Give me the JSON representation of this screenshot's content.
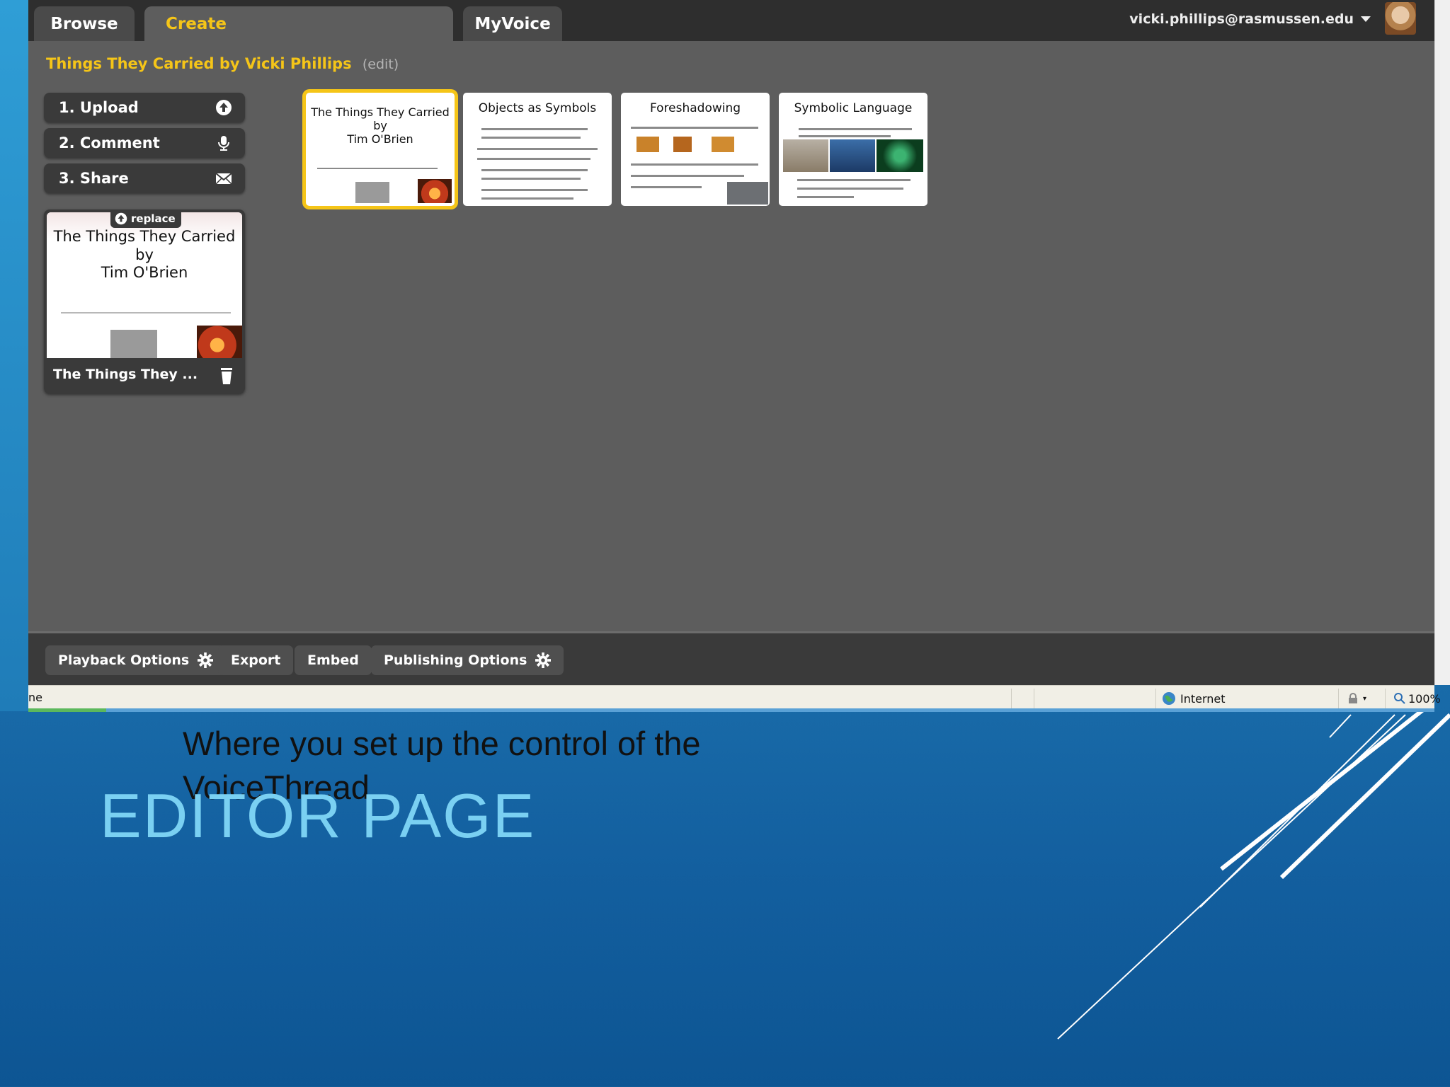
{
  "nav": {
    "tabs": [
      {
        "label": "Browse"
      },
      {
        "label": "Create"
      },
      {
        "label": "MyVoice"
      }
    ],
    "user_email": "vicki.phillips@rasmussen.edu"
  },
  "thread": {
    "title": "Things They Carried by Vicki Phillips",
    "edit_label": "(edit)"
  },
  "steps": [
    {
      "label": "1. Upload",
      "icon": "upload-icon"
    },
    {
      "label": "2. Comment",
      "icon": "microphone-icon"
    },
    {
      "label": "3. Share",
      "icon": "envelope-icon"
    }
  ],
  "selected_slide": {
    "replace_label": "replace",
    "title_line1": "The Things They Carried",
    "title_line2": "by",
    "title_line3": "Tim O'Brien",
    "caption": "The Things They ..."
  },
  "thumbnails": [
    {
      "title": "The Things They Carried",
      "sub1": "by",
      "sub2": "Tim O'Brien"
    },
    {
      "title": "Objects as Symbols"
    },
    {
      "title": "Foreshadowing"
    },
    {
      "title": "Symbolic Language"
    }
  ],
  "bottom_buttons": [
    {
      "label": "Playback Options",
      "icon": "gear-icon"
    },
    {
      "label": "Export"
    },
    {
      "label": "Embed"
    },
    {
      "label": "Publishing Options",
      "icon": "gear-icon"
    }
  ],
  "status_bar": {
    "left_text": "ne",
    "zone": "Internet",
    "zoom": "100%"
  },
  "slide": {
    "subtitle": "Where you set up the control of the VoiceThread",
    "heading": "EDITOR PAGE"
  },
  "colors": {
    "accent": "#f5c518",
    "heading": "#7ad0f2",
    "app_bg": "#5d5d5d",
    "topbar": "#2e2e2e"
  }
}
